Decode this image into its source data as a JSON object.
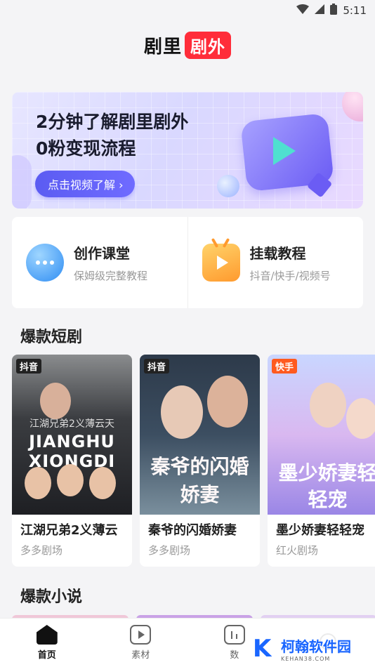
{
  "status_bar": {
    "time": "5:11"
  },
  "header": {
    "brand_left": "剧里",
    "brand_right": "剧外"
  },
  "banner": {
    "line1": "2分钟了解剧里剧外",
    "line2": "0粉变现流程",
    "cta": "点击视频了解 ›"
  },
  "quick": [
    {
      "title": "创作课堂",
      "subtitle": "保姆级完整教程",
      "icon": "chat-bubble-icon"
    },
    {
      "title": "挂载教程",
      "subtitle": "抖音/快手/视频号",
      "icon": "tv-icon"
    }
  ],
  "sections": {
    "drama": "爆款短剧",
    "novel": "爆款小说"
  },
  "dramas": [
    {
      "platform": "抖音",
      "title": "江湖兄弟2义薄云",
      "source": "多多剧场",
      "art": "JIANGHU XIONGDI",
      "art_top": "江湖兄弟2义薄云天"
    },
    {
      "platform": "抖音",
      "title": "秦爷的闪婚娇妻",
      "source": "多多剧场",
      "art": "秦爷的闪婚娇妻"
    },
    {
      "platform": "快手",
      "title": "墨少娇妻轻轻宠",
      "source": "红火剧场",
      "art": "墨少娇妻轻轻宠"
    }
  ],
  "tabs": [
    {
      "label": "首页",
      "icon": "home-icon",
      "active": true
    },
    {
      "label": "素材",
      "icon": "play-square-icon"
    },
    {
      "label": "数",
      "icon": "data-icon"
    },
    {
      "label": "",
      "icon": "user-icon"
    }
  ],
  "watermark": {
    "title": "柯翰软件园",
    "url": "KEHAN38.COM",
    "logo": "K"
  },
  "colors": {
    "brand_red": "#ff2d3a",
    "accent_purple": "#5b5cf2",
    "douyin_tag": "#222222",
    "kuaishou_tag": "#ff5a1f"
  }
}
